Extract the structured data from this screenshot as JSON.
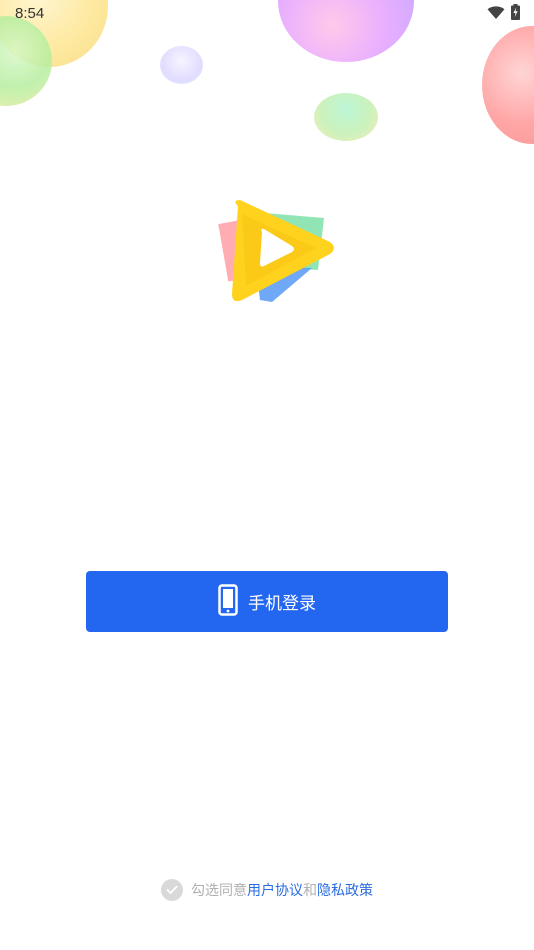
{
  "status_bar": {
    "time": "8:54",
    "icons": [
      "wifi-icon",
      "battery-charging-icon"
    ]
  },
  "colors": {
    "primary": "#2367f0",
    "link": "#2a6de0",
    "muted_text": "#b0b0b0",
    "checkbox_unchecked": "#d9d9d9"
  },
  "logo": {
    "icon": "video-play-logo"
  },
  "login": {
    "icon": "mobile-phone-icon",
    "label": "手机登录"
  },
  "agreement": {
    "checked": false,
    "prefix": "勾选同意",
    "user_agreement": "用户协议",
    "conjunction": "和",
    "privacy_policy": "隐私政策"
  }
}
